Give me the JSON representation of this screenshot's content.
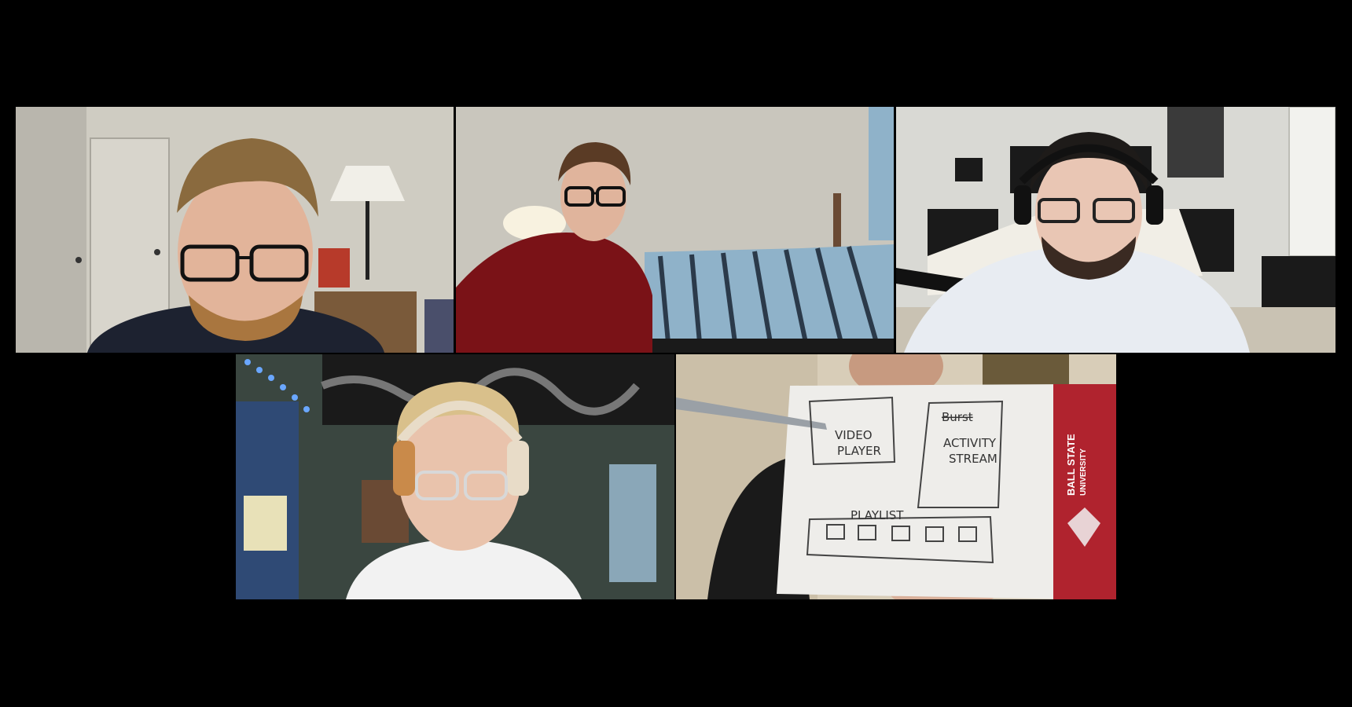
{
  "window": {
    "view_mode": "gallery",
    "background": "#000000"
  },
  "participants": [
    {
      "id": "p1",
      "icon": "participant-video",
      "palette": {
        "wall": "#cfccc2",
        "shirt": "#1d2230",
        "hair": "#8a6a3e"
      }
    },
    {
      "id": "p2",
      "icon": "participant-video",
      "palette": {
        "wall": "#c9c6bd",
        "shirt": "#7a1217",
        "hair": "#5a3b25"
      }
    },
    {
      "id": "p3",
      "icon": "participant-video",
      "palette": {
        "wall": "#d9d9d4",
        "shirt": "#e8ecf2",
        "hair": "#1e1b19"
      }
    },
    {
      "id": "p4",
      "icon": "participant-video",
      "palette": {
        "wall": "#3a4640",
        "shirt": "#f2f2f2",
        "hair": "#d9c08b"
      }
    },
    {
      "id": "p5",
      "icon": "participant-video",
      "palette": {
        "wall": "#d8cdb8",
        "shirt": "#1a1a1a",
        "hair": "#3a2a20"
      }
    }
  ],
  "sketch": {
    "video_box": [
      "VIDEO",
      "PLAYER"
    ],
    "activity_box": [
      "ACTIVITY",
      "STREAM"
    ],
    "activity_scribble": "Burst",
    "playlist_label": "PLAYLIST",
    "brand_lines": [
      "BALL STATE",
      "UNIVERSITY"
    ],
    "brand_color": "#b0232e"
  }
}
